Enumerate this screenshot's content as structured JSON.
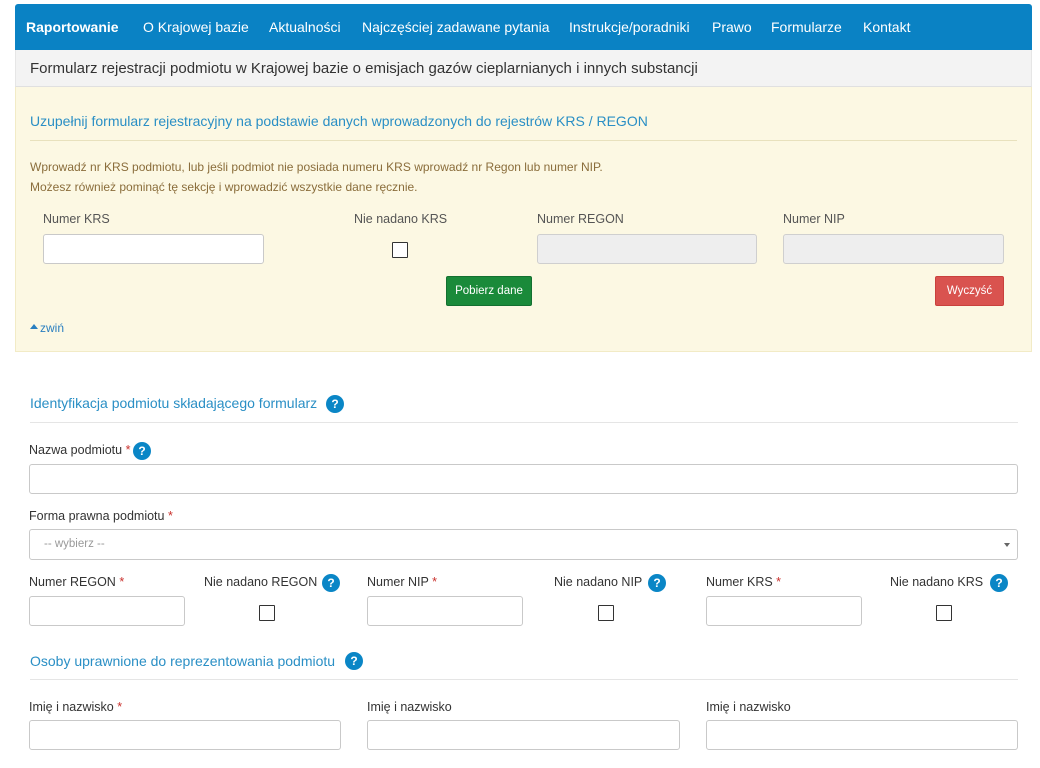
{
  "nav": {
    "items": [
      "Raportowanie",
      "O Krajowej bazie",
      "Aktualności",
      "Najczęściej zadawane pytania",
      "Instrukcje/poradniki",
      "Prawo",
      "Formularze",
      "Kontakt"
    ]
  },
  "page": {
    "title": "Formularz rejestracji podmiotu w Krajowej bazie o emisjach gazów cieplarnianych i innych substancji"
  },
  "lookup": {
    "heading": "Uzupełnij formularz rejestracyjny na podstawie danych wprowadzonych do rejestrów KRS / REGON",
    "hint1": "Wprowadź nr KRS podmiotu, lub jeśli podmiot nie posiada numeru KRS wprowadź nr Regon lub numer NIP.",
    "hint2": "Możesz również pominąć tę sekcję i wprowadzić wszystkie dane ręcznie.",
    "krs_label": "Numer KRS",
    "krs_value": "",
    "no_krs_label": "Nie nadano KRS",
    "regon_label": "Numer REGON",
    "nip_label": "Numer NIP",
    "fetch_button": "Pobierz dane",
    "clear_button": "Wyczyść",
    "collapse_link": "zwiń"
  },
  "identification": {
    "heading": "Identyfikacja podmiotu składającego formularz",
    "name_label": "Nazwa podmiotu",
    "legal_form_label": "Forma prawna podmiotu",
    "legal_form_value": "-- wybierz --",
    "regon_label": "Numer REGON",
    "no_regon_label": "Nie nadano REGON",
    "nip_label": "Numer NIP",
    "no_nip_label": "Nie nadano NIP",
    "krs_label": "Numer KRS",
    "no_krs_label": "Nie nadano KRS",
    "required_mark": "*",
    "help_glyph": "?"
  },
  "representatives": {
    "heading": "Osoby uprawnione do reprezentowania podmiotu",
    "person_labels": [
      "Imię i nazwisko",
      "Imię i nazwisko",
      "Imię i nazwisko"
    ]
  },
  "colors": {
    "navbar": "#0a82c4",
    "panel_bg": "#fcf8e3",
    "heading_blue": "#2a8fc5",
    "btn_green": "#1a8a3a",
    "btn_red": "#d9534f"
  }
}
